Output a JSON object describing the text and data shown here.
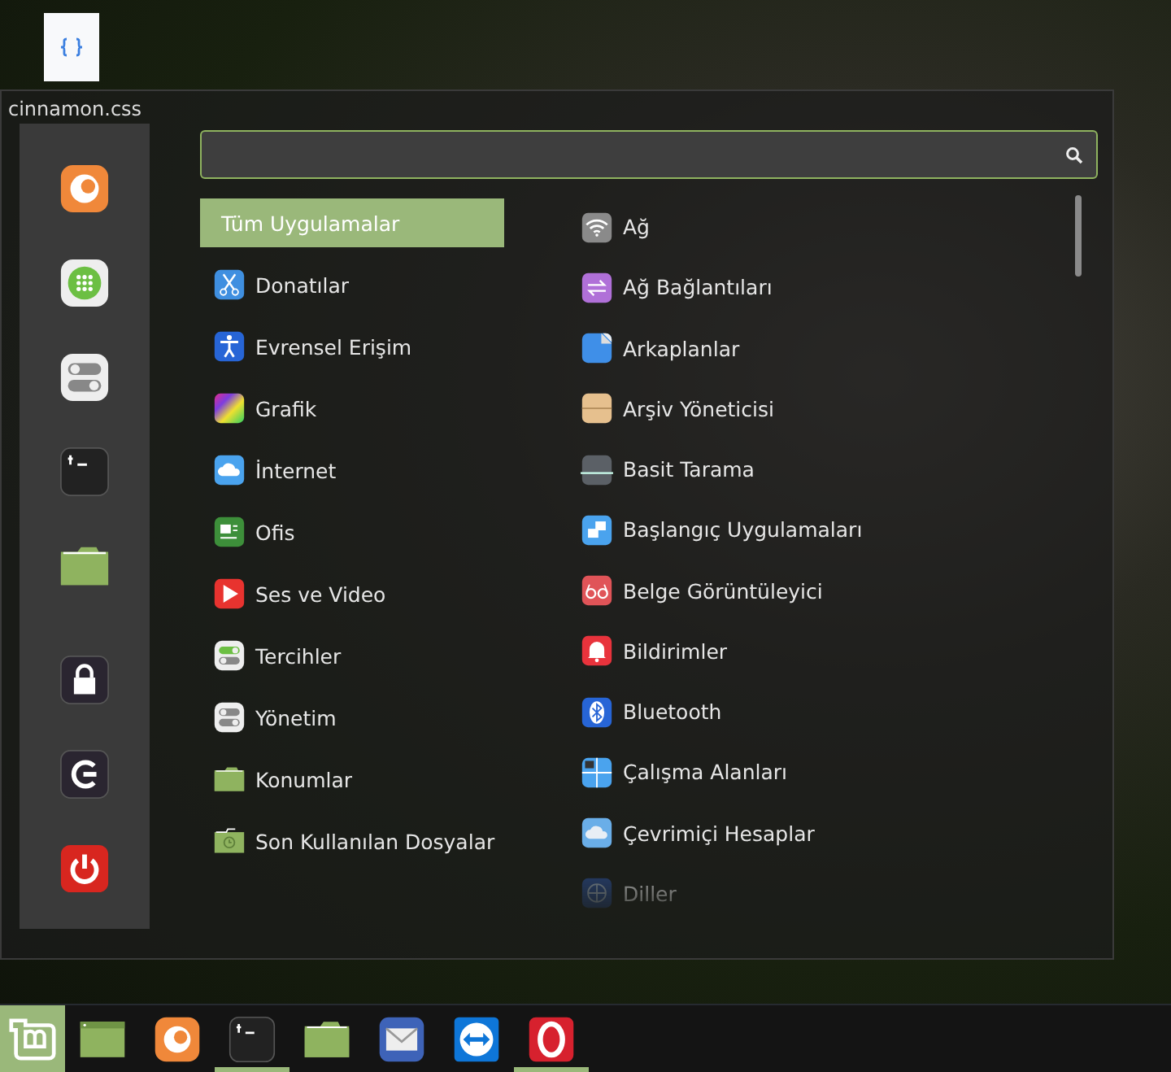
{
  "desktop": {
    "file_label": "cinnamon.css"
  },
  "menu": {
    "open": true,
    "sidebar": {
      "items": [
        {
          "kind": "app"
        },
        {
          "kind": "app"
        },
        {
          "kind": "app"
        },
        {
          "kind": "app"
        },
        {
          "kind": "app"
        },
        {
          "kind": "session"
        },
        {
          "kind": "session"
        },
        {
          "kind": "session"
        }
      ]
    },
    "categories": [
      {
        "label": "Tüm Uygulamalar",
        "selected": true
      },
      {
        "label": "Donatılar",
        "selected": false
      },
      {
        "label": "Evrensel Erişim",
        "selected": false
      },
      {
        "label": "Grafik",
        "selected": false
      },
      {
        "label": "İnternet",
        "selected": false
      },
      {
        "label": "Ofis",
        "selected": false
      },
      {
        "label": "Ses ve Video",
        "selected": false
      },
      {
        "label": "Tercihler",
        "selected": false
      },
      {
        "label": "Yönetim",
        "selected": false
      },
      {
        "label": "Konumlar",
        "selected": false
      },
      {
        "label": "Son Kullanılan Dosyalar",
        "selected": false
      }
    ],
    "apps": [
      {
        "label": "Ağ"
      },
      {
        "label": "Ağ Bağlantıları"
      },
      {
        "label": "Arkaplanlar"
      },
      {
        "label": "Arşiv Yöneticisi"
      },
      {
        "label": "Basit Tarama"
      },
      {
        "label": "Başlangıç Uygulamaları"
      },
      {
        "label": "Belge Görüntüleyici"
      },
      {
        "label": "Bildirimler"
      },
      {
        "label": "Bluetooth"
      },
      {
        "label": "Çalışma Alanları"
      },
      {
        "label": "Çevrimiçi Hesaplar"
      },
      {
        "label": "Diller"
      }
    ]
  },
  "taskbar": {
    "items": [
      {
        "running": false
      },
      {
        "running": false
      },
      {
        "running": true
      },
      {
        "running": false
      },
      {
        "running": false
      },
      {
        "running": false
      },
      {
        "running": true
      }
    ]
  }
}
